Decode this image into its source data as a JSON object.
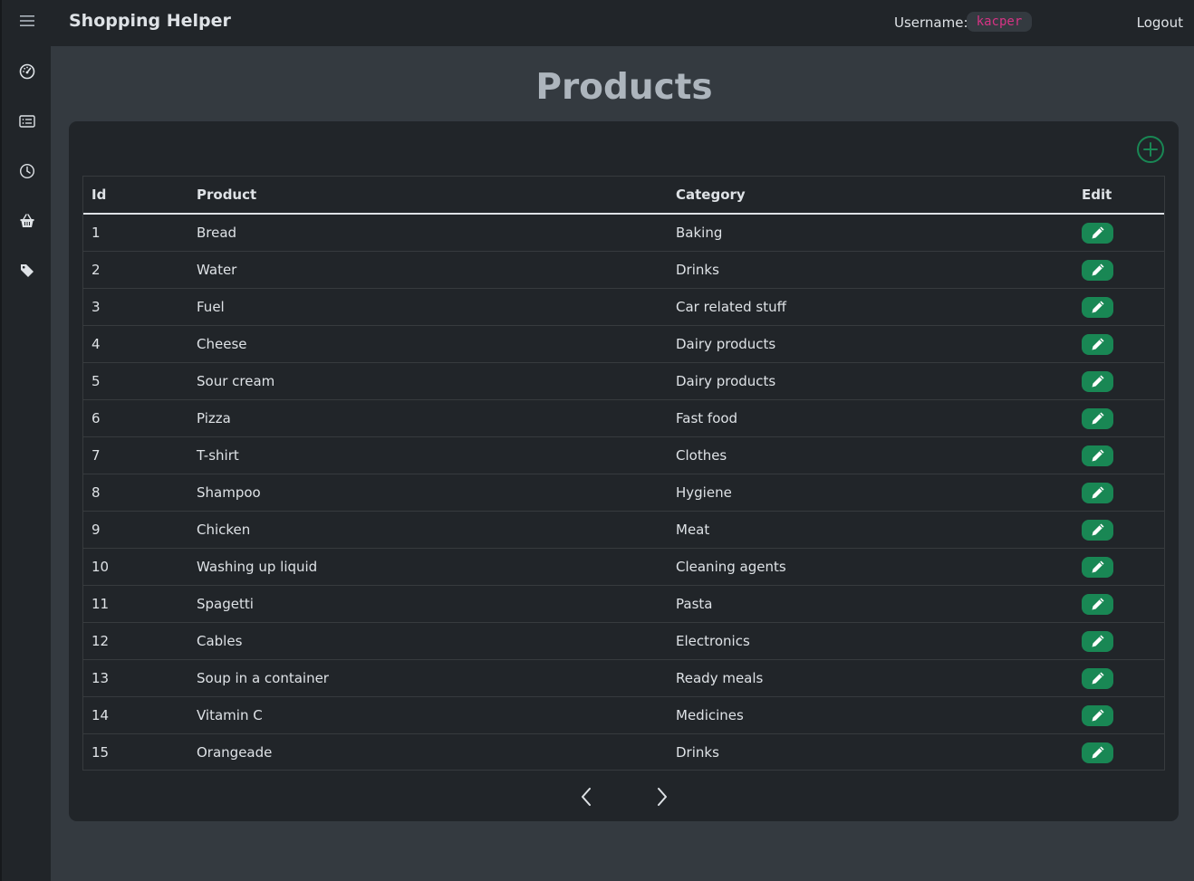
{
  "app": {
    "brand": "Shopping Helper",
    "username_label": "Username:",
    "username": "kacper",
    "logout": "Logout"
  },
  "sidebar": {
    "items": [
      {
        "icon": "menu-icon"
      },
      {
        "icon": "speedometer-icon"
      },
      {
        "icon": "card-list-icon"
      },
      {
        "icon": "clock-icon"
      },
      {
        "icon": "basket-icon"
      },
      {
        "icon": "tags-icon"
      }
    ]
  },
  "page": {
    "title": "Products"
  },
  "colors": {
    "accent_green": "#198754",
    "username_pink": "#d63384"
  },
  "table": {
    "headers": [
      "Id",
      "Product",
      "Category",
      "Edit"
    ],
    "rows": [
      {
        "id": "1",
        "product": "Bread",
        "category": "Baking"
      },
      {
        "id": "2",
        "product": "Water",
        "category": "Drinks"
      },
      {
        "id": "3",
        "product": "Fuel",
        "category": "Car related stuff"
      },
      {
        "id": "4",
        "product": "Cheese",
        "category": "Dairy products"
      },
      {
        "id": "5",
        "product": "Sour cream",
        "category": "Dairy products"
      },
      {
        "id": "6",
        "product": "Pizza",
        "category": "Fast food"
      },
      {
        "id": "7",
        "product": "T-shirt",
        "category": "Clothes"
      },
      {
        "id": "8",
        "product": "Shampoo",
        "category": "Hygiene"
      },
      {
        "id": "9",
        "product": "Chicken",
        "category": "Meat"
      },
      {
        "id": "10",
        "product": "Washing up liquid",
        "category": "Cleaning agents"
      },
      {
        "id": "11",
        "product": "Spagetti",
        "category": "Pasta"
      },
      {
        "id": "12",
        "product": "Cables",
        "category": "Electronics"
      },
      {
        "id": "13",
        "product": "Soup in a container",
        "category": "Ready meals"
      },
      {
        "id": "14",
        "product": "Vitamin C",
        "category": "Medicines"
      },
      {
        "id": "15",
        "product": "Orangeade",
        "category": "Drinks"
      }
    ]
  }
}
